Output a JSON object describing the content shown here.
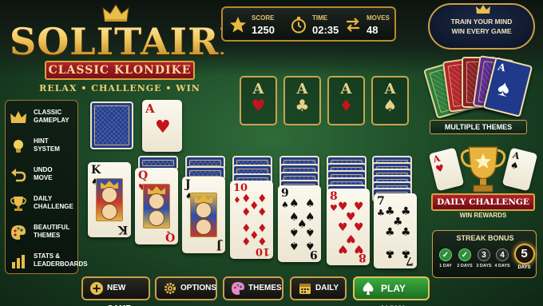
{
  "logo": {
    "title": "SOLITAIRE",
    "subtitle": "CLASSIC KLONDIKE",
    "tagline": "RELAX • CHALLENGE • WIN"
  },
  "stats": {
    "score_label": "SCORE",
    "score_value": "1250",
    "time_label": "TIME",
    "time_value": "02:35",
    "moves_label": "MOVES",
    "moves_value": "48"
  },
  "features": [
    {
      "icon": "crown-icon",
      "label_line1": "CLASSIC",
      "label_line2": "GAMEPLAY"
    },
    {
      "icon": "lightbulb-icon",
      "label_line1": "HINT",
      "label_line2": "SYSTEM"
    },
    {
      "icon": "undo-icon",
      "label_line1": "UNDO",
      "label_line2": "MOVE"
    },
    {
      "icon": "trophy-icon",
      "label_line1": "DAILY",
      "label_line2": "CHALLENGE"
    },
    {
      "icon": "palette-icon",
      "label_line1": "BEAUTIFUL",
      "label_line2": "THEMES"
    },
    {
      "icon": "bar-chart-icon",
      "label_line1": "STATS &",
      "label_line2": "LEADERBOARDS"
    }
  ],
  "waste_card": {
    "rank": "A",
    "suit": "♥"
  },
  "foundations": [
    {
      "rank": "A",
      "suit": "♥"
    },
    {
      "rank": "A",
      "suit": "♣"
    },
    {
      "rank": "A",
      "suit": "♦"
    },
    {
      "rank": "A",
      "suit": "♠"
    }
  ],
  "tableau": [
    {
      "rank": "K",
      "suit": "♠",
      "hidden": 0
    },
    {
      "rank": "Q",
      "suit": "♥",
      "hidden": 1
    },
    {
      "rank": "J",
      "suit": "♠",
      "hidden": 2
    },
    {
      "rank": "10",
      "suit": "♦",
      "hidden": 3
    },
    {
      "rank": "9",
      "suit": "♠",
      "hidden": 4
    },
    {
      "rank": "8",
      "suit": "♥",
      "hidden": 5
    },
    {
      "rank": "7",
      "suit": "♣",
      "hidden": 6
    }
  ],
  "promo": {
    "train_line1": "TRAIN YOUR MIND",
    "train_line2": "WIN EVERY GAME",
    "themes_label": "MULTIPLE THEMES",
    "themes_card_rank": "A",
    "themes_card_suit": "♠",
    "daily_label": "DAILY CHALLENGE",
    "daily_sub": "WIN REWARDS",
    "daily_card_rank": "A",
    "daily_card_suit": "♥"
  },
  "streak": {
    "title": "STREAK BONUS",
    "days": [
      {
        "mark": "✓",
        "label": "1 DAY",
        "done": true
      },
      {
        "mark": "✓",
        "label": "2 DAYS",
        "done": true
      },
      {
        "mark": "3",
        "label": "3 DAYS",
        "done": false
      },
      {
        "mark": "4",
        "label": "4 DAYS",
        "done": false
      }
    ],
    "current_mark": "5",
    "current_label": "DAYS"
  },
  "buttons": {
    "new_game": "NEW GAME",
    "options": "OPTIONS",
    "themes": "THEMES",
    "daily": "DAILY",
    "play_now": "PLAY NOW"
  },
  "colors": {
    "felt": "#2f6b3a",
    "gold": "#c9a04a",
    "card_red": "#c3141b",
    "card_back": "#233d8e",
    "play_green": "#3cab3e"
  }
}
